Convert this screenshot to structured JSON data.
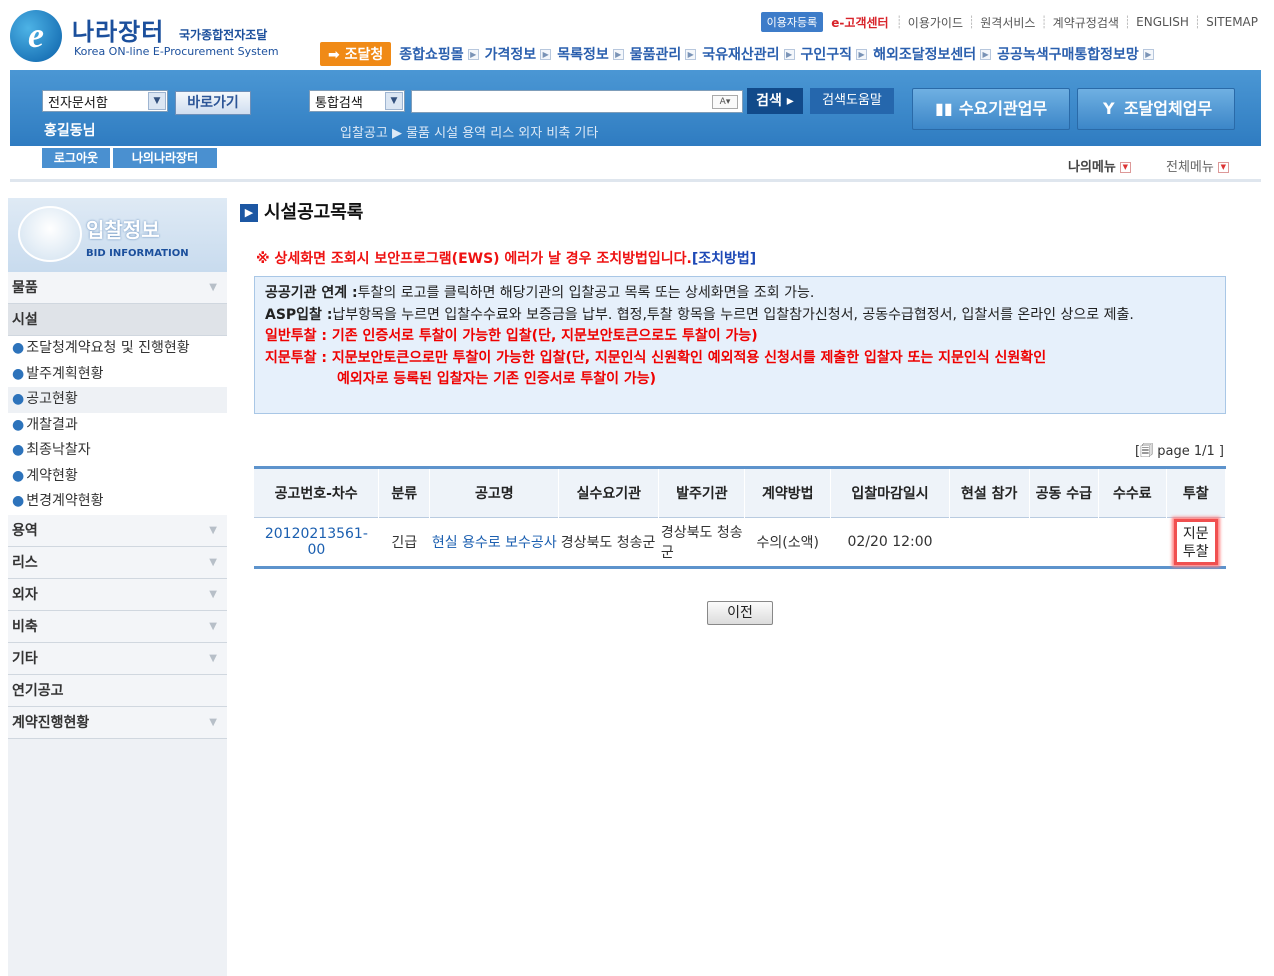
{
  "header": {
    "logo_name": "나라장터",
    "logo_sub": "국가종합전자조달",
    "logo_en": "Korea ON-line E-Procurement System",
    "logo_icon": "e-logo-icon"
  },
  "util": {
    "register": "이용자등록",
    "cs": "e-고객센터",
    "links": [
      "이용가이드",
      "원격서비스",
      "계약규정검색",
      "ENGLISH",
      "SITEMAP"
    ]
  },
  "gnav": {
    "main": "조달청",
    "items": [
      "종합쇼핑몰",
      "가격정보",
      "목록정보",
      "물품관리",
      "국유재산관리",
      "구인구직",
      "해외조달정보센터",
      "공공녹색구매통합정보망"
    ]
  },
  "toolbar": {
    "doc_select": "전자문서함",
    "go_button": "바로가기",
    "user": "홍길동님",
    "logout": "로그아웃",
    "my_nara": "나의나라장터",
    "search_select": "통합검색",
    "search_value": "",
    "search_ime": "A▾",
    "search_button": "검색",
    "search_help": "검색도움말",
    "quick_links": "입찰공고 ▶ 물품 시설 용역 리스 외자 비축 기타",
    "need_agency": "수요기관업무",
    "supplier": "조달업체업무",
    "my_menu": "나의메뉴",
    "all_menu": "전체메뉴"
  },
  "sidebar": {
    "title": "입찰정보",
    "subtitle": "BID INFORMATION",
    "menu_top": [
      {
        "label": "물품",
        "active": false
      },
      {
        "label": "시설",
        "active": true
      }
    ],
    "subs": [
      {
        "label": "조달청계약요청 및 진행현황",
        "active": false
      },
      {
        "label": "발주계획현황",
        "active": false
      },
      {
        "label": "공고현황",
        "active": true
      },
      {
        "label": "개찰결과",
        "active": false
      },
      {
        "label": "최종낙찰자",
        "active": false
      },
      {
        "label": "계약현황",
        "active": false
      },
      {
        "label": "변경계약현황",
        "active": false
      }
    ],
    "menu_bottom": [
      {
        "label": "용역",
        "arrow": true
      },
      {
        "label": "리스",
        "arrow": true
      },
      {
        "label": "외자",
        "arrow": true
      },
      {
        "label": "비축",
        "arrow": true
      },
      {
        "label": "기타",
        "arrow": true
      },
      {
        "label": "연기공고",
        "arrow": false
      },
      {
        "label": "계약진행현황",
        "arrow": true
      }
    ]
  },
  "main": {
    "title": "시설공고목록",
    "warning": "※ 상세화면 조회시 보안프로그램(EWS) 에러가 날 경우 조치방법입니다.",
    "warning_link": "[조치방법]",
    "info": {
      "l1_b": "공공기관 연계 :",
      "l1": "투찰의 로고를 클릭하면 해당기관의 입찰공고 목록 또는 상세화면을 조회 가능.",
      "l2_b": "ASP입찰 :",
      "l2": "납부항목을 누르면 입찰수수료와 보증금을 납부.  협정,투찰 항목을 누르면 입찰참가신청서, 공동수급협정서, 입찰서를 온라인 상으로 제출.",
      "l3": "일반투찰 : 기존 인증서로 투찰이 가능한 입찰(단, 지문보안토큰으로도 투찰이 가능)",
      "l4": "지문투찰 : 지문보안토큰으로만 투찰이 가능한 입찰(단, 지문인식 신원확인 예외적용 신청서를 제출한 입찰자 또는 지문인식 신원확인",
      "l5": "예외자로 등록된 입찰자는 기존 인증서로 투찰이 가능)"
    },
    "page": "page 1/1 ]",
    "page_prefix": "[",
    "table": {
      "headers": [
        "공고번호-차수",
        "분류",
        "공고명",
        "실수요기관",
        "발주기관",
        "계약방법",
        "입찰마감일시",
        "현설 참가",
        "공동 수급",
        "수수료",
        "투찰"
      ],
      "row": {
        "no": "20120213561-00",
        "cat": "긴급",
        "name": "현실 용수로 보수공사",
        "demand": "경상북도 청송군",
        "order": "경상북도 청송군",
        "method": "수의(소액)",
        "deadline": "02/20 12:00",
        "site": "",
        "joint": "",
        "fee": "",
        "bid": "지문 투찰"
      }
    },
    "prev": "이전"
  }
}
